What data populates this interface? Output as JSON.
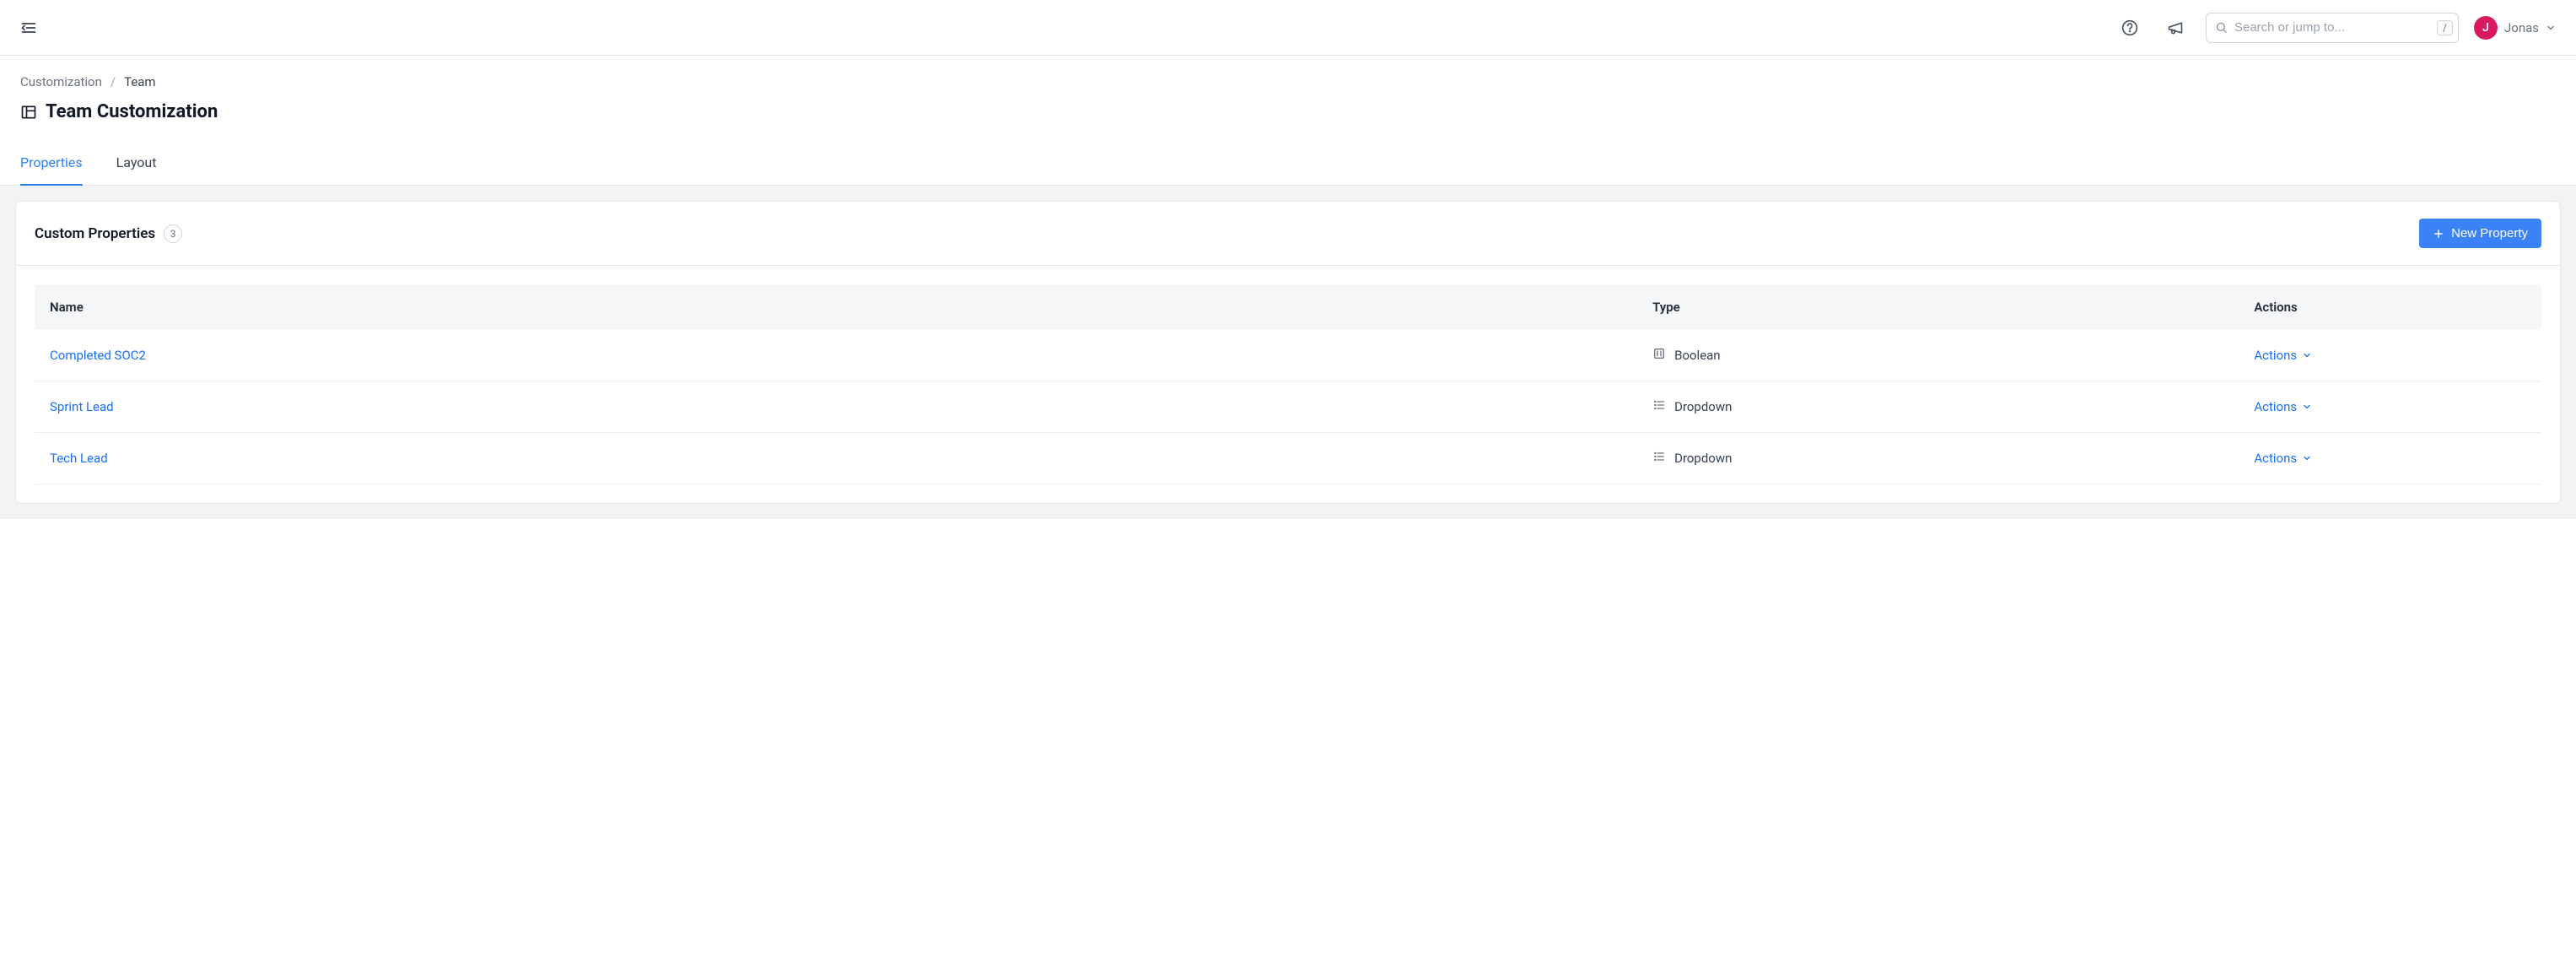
{
  "header": {
    "search_placeholder": "Search or jump to...",
    "search_shortcut": "/",
    "user_name": "Jonas",
    "user_initial": "J"
  },
  "breadcrumb": {
    "root": "Customization",
    "current": "Team"
  },
  "page": {
    "title": "Team Customization"
  },
  "tabs": [
    {
      "label": "Properties",
      "active": true
    },
    {
      "label": "Layout",
      "active": false
    }
  ],
  "panel": {
    "title": "Custom Properties",
    "count": "3",
    "new_button": "New Property"
  },
  "table": {
    "columns": {
      "name": "Name",
      "type": "Type",
      "actions": "Actions"
    },
    "action_label": "Actions",
    "rows": [
      {
        "name": "Completed SOC2",
        "type": "Boolean",
        "type_icon": "boolean"
      },
      {
        "name": "Sprint Lead",
        "type": "Dropdown",
        "type_icon": "dropdown"
      },
      {
        "name": "Tech Lead",
        "type": "Dropdown",
        "type_icon": "dropdown"
      }
    ]
  }
}
